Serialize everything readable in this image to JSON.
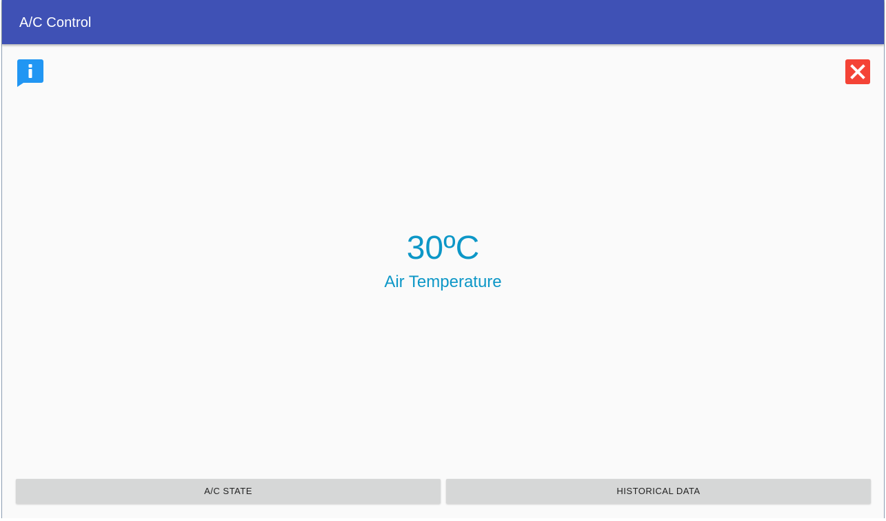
{
  "app_bar": {
    "title": "A/C Control"
  },
  "icons": {
    "info": "info-speech-bubble-icon",
    "close": "close-x-icon"
  },
  "reading": {
    "value": "30ºC",
    "label": "Air Temperature"
  },
  "buttons": {
    "ac_state": "A/C STATE",
    "historical": "HISTORICAL DATA"
  },
  "colors": {
    "app_bar": "#3f51b5",
    "accent_text": "#0d97c7",
    "info_icon": "#2196f3",
    "close_icon": "#f44336",
    "button_bg": "#d6d7d7",
    "background": "#fafafa"
  }
}
